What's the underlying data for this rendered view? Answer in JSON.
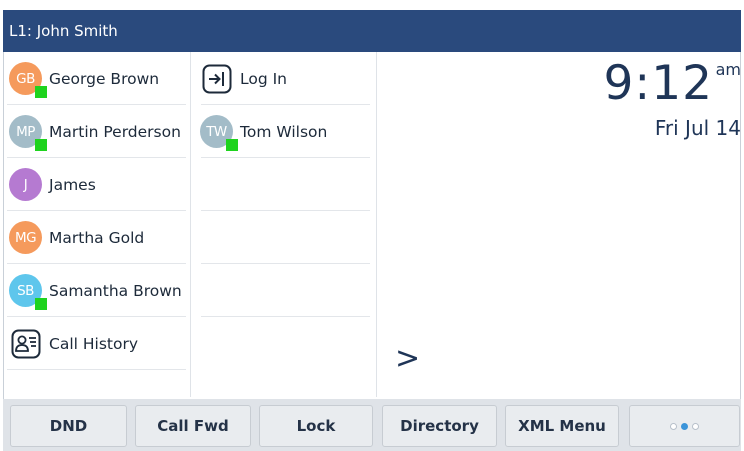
{
  "header": {
    "line_label": "L1: John Smith"
  },
  "column_left": [
    {
      "type": "contact",
      "initials": "GB",
      "name": "George Brown",
      "avatar_color": "#f59a5c",
      "presence": true
    },
    {
      "type": "contact",
      "initials": "MP",
      "name": "Martin Perderson",
      "avatar_color": "#a3bcc8",
      "presence": true
    },
    {
      "type": "contact",
      "initials": "J",
      "name": "James",
      "avatar_color": "#b57ad1",
      "presence": false
    },
    {
      "type": "contact",
      "initials": "MG",
      "name": "Martha Gold",
      "avatar_color": "#f59a5c",
      "presence": false
    },
    {
      "type": "contact",
      "initials": "SB",
      "name": "Samantha Brown",
      "avatar_color": "#5ec6ec",
      "presence": true
    },
    {
      "type": "function",
      "icon": "call-history-icon",
      "name": "Call History"
    }
  ],
  "column_right": [
    {
      "type": "function",
      "icon": "login-icon",
      "name": "Log In"
    },
    {
      "type": "contact",
      "initials": "TW",
      "name": "Tom Wilson",
      "avatar_color": "#a3bcc8",
      "presence": true
    }
  ],
  "clock": {
    "time": "9:12",
    "ampm": "am",
    "date": "Fri Jul 14"
  },
  "more_indicator": ">",
  "softkeys": [
    {
      "label": "DND"
    },
    {
      "label": "Call Fwd"
    },
    {
      "label": "Lock"
    },
    {
      "label": "Directory"
    },
    {
      "label": "XML Menu"
    }
  ],
  "page_indicator": {
    "pages": 3,
    "active": 2
  },
  "colors": {
    "header": "#2a4a7d",
    "presence": "#1ed31e",
    "accent": "#3b94d9"
  }
}
